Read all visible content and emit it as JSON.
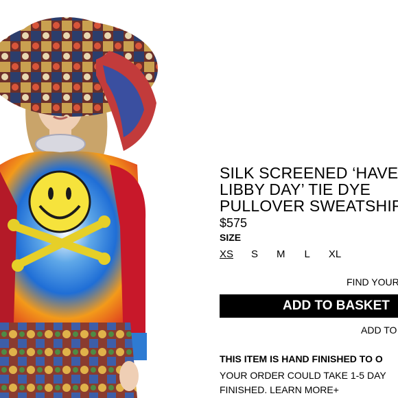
{
  "product": {
    "title_lines": [
      "SILK SCREENED ‘HAVE",
      "LIBBY DAY’ TIE DYE",
      "PULLOVER SWEATSHIR"
    ],
    "price": "$575",
    "size_label": "SIZE",
    "sizes": [
      "XS",
      "S",
      "M",
      "L",
      "XL"
    ],
    "selected_size": "XS",
    "find_link": "FIND YOUR",
    "add_to_basket": "ADD TO BASKET",
    "add_to_link": "ADD TO",
    "notice_title": "THIS ITEM IS HAND FINISHED TO O",
    "notice_body": [
      "YOUR ORDER COULD TAKE 1-5 DAY",
      "FINISHED. LEARN MORE+"
    ]
  },
  "colors": {
    "button_bg": "#000000",
    "button_text": "#ffffff"
  },
  "image": {
    "subject": "model wearing oversized patchwork hat and tie dye smiley sweatshirt"
  }
}
